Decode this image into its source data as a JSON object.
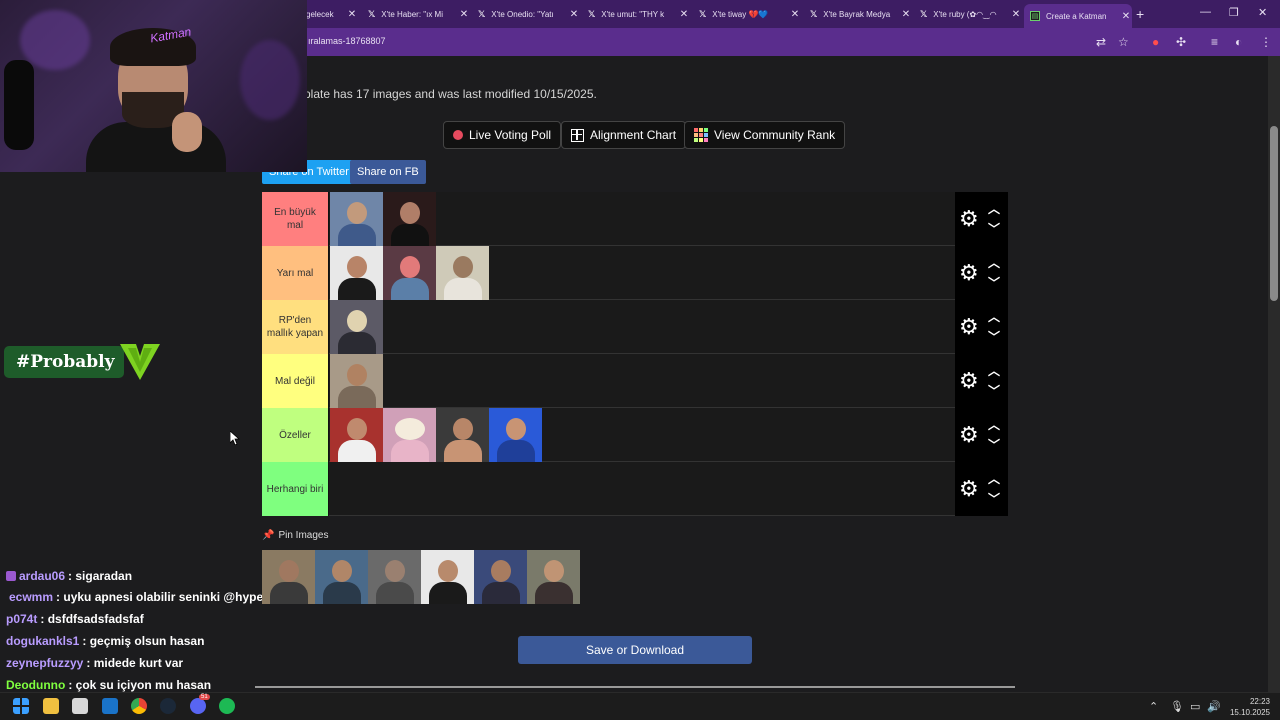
{
  "browser": {
    "tabs": [
      {
        "title": "gelecek",
        "close": "✕"
      },
      {
        "title": "X'te Haber: \"ıx Mi",
        "close": "✕"
      },
      {
        "title": "X'te Onedio: \"Yatı",
        "close": "✕"
      },
      {
        "title": "X'te umut: \"THY k",
        "close": "✕"
      },
      {
        "title": "X'te tiway 💔💙",
        "close": "✕"
      },
      {
        "title": "X'te Bayrak Medya",
        "close": "✕"
      },
      {
        "title": "X'te ruby (✿◠‿◠",
        "close": "✕"
      },
      {
        "title": "Create a Katman",
        "close": "✕"
      }
    ],
    "new_tab": "+",
    "url": "ıralamas-18768807"
  },
  "page": {
    "info": "plate has 17 images and was last modified 10/15/2025.",
    "buttons": {
      "live_voting": "Live Voting Poll",
      "alignment": "Alignment Chart",
      "community_rank": "View Community Rank"
    },
    "share": {
      "twitter": "Share on Twitter",
      "fb": "Share on FB"
    },
    "tiers": [
      {
        "label": "En büyük mal",
        "color": "#ff7f7f",
        "items": 2
      },
      {
        "label": "Yarı mal",
        "color": "#ffbf7f",
        "items": 3
      },
      {
        "label": "RP'den mallık yapan",
        "color": "#ffdf7f",
        "items": 1
      },
      {
        "label": "Mal değil",
        "color": "#ffff7f",
        "items": 1
      },
      {
        "label": "Özeller",
        "color": "#bfff7f",
        "items": 4
      },
      {
        "label": "Herhangi biri",
        "color": "#7fff7f",
        "items": 0
      }
    ],
    "pin_images": "Pin Images",
    "save_button": "Save or Download"
  },
  "overlay": {
    "badge": "#Probably",
    "cam_sign": "Katman",
    "chat": [
      {
        "user": "ardau06",
        "msg": ": sigaradan",
        "color": "#b99cff"
      },
      {
        "user": "ecwmm",
        "msg": ": uyku apnesi olabilir seninki @hype",
        "color": "#b99cff"
      },
      {
        "user": "p074t",
        "msg": ": dsfdfsadsfadsfaf",
        "color": "#b99cff"
      },
      {
        "user": "dogukankls1",
        "msg": ": geçmiş olsun hasan",
        "color": "#b99cff"
      },
      {
        "user": "zeynepfuzzyy",
        "msg": ": midede kurt var",
        "color": "#b99cff"
      },
      {
        "user": "Deodunno",
        "msg": ": çok su içiyon mu hasan",
        "color": "#7fff3f"
      }
    ]
  },
  "taskbar": {
    "time": "22:23",
    "date": "15.10.2025",
    "discord_badge": "51"
  }
}
